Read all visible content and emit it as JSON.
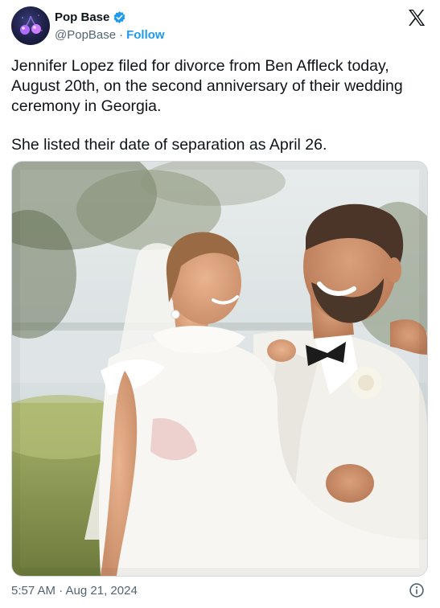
{
  "author": {
    "display_name": "Pop Base",
    "handle": "@PopBase",
    "separator": "·",
    "follow_label": "Follow",
    "verified": true
  },
  "tweet": {
    "paragraph_1": "Jennifer Lopez filed for divorce from Ben Affleck today, August 20th, on the second anniversary of their wedding ceremony in Georgia.",
    "paragraph_2": "She listed their date of separation as April 26.",
    "media_type": "photo"
  },
  "footer": {
    "timestamp": "5:57 AM · Aug 21, 2024"
  },
  "colors": {
    "accent": "#1d9bf0",
    "text_primary": "#0f1419",
    "text_secondary": "#536471"
  },
  "icons": [
    "avatar-image",
    "verified-badge-icon",
    "x-logo-icon",
    "info-icon"
  ]
}
